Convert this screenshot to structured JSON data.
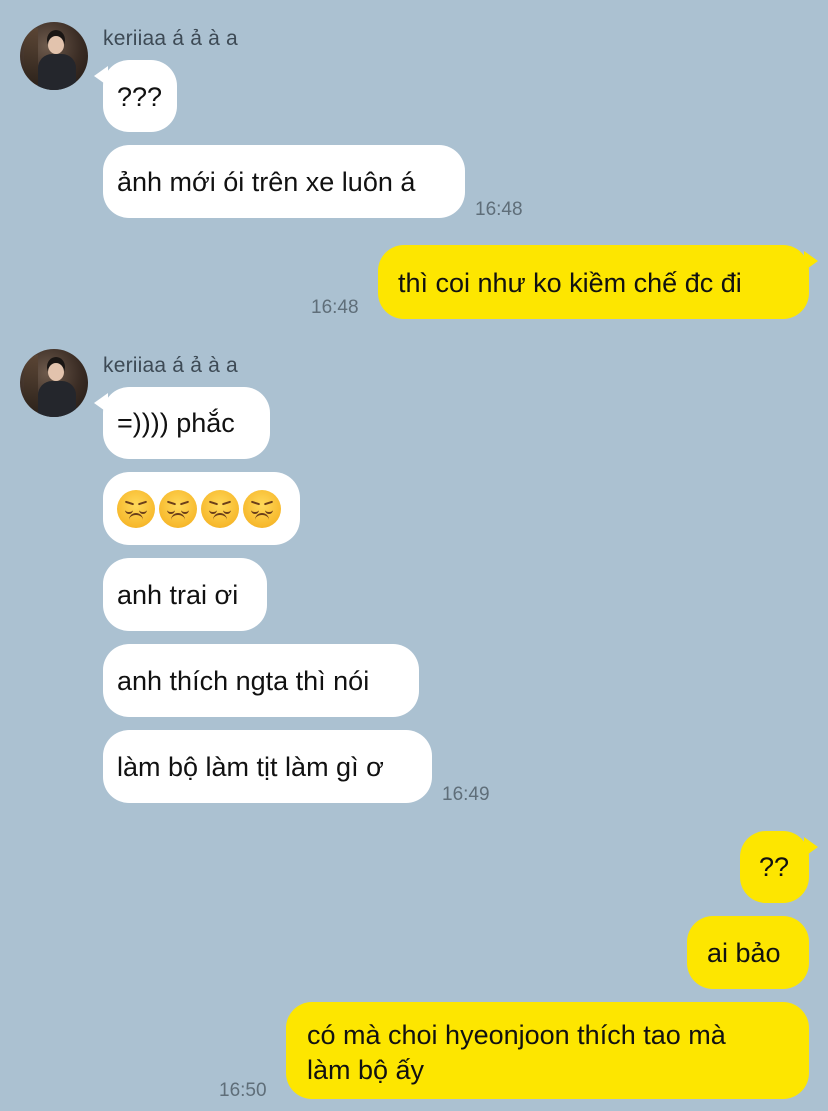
{
  "chat": {
    "contact_name": "keriiaa á ả à a",
    "groups": [
      {
        "time": "16:48",
        "messages": [
          "???",
          "ảnh mới ói trên xe luôn á"
        ]
      },
      {
        "time": "16:48",
        "messages": [
          "thì coi như ko kiềm chế đc đi"
        ]
      },
      {
        "time": "16:49",
        "messages": [
          "=)))) phắc",
          "😞😞😞😞",
          "anh trai ơi",
          "anh thích ngta thì nói",
          "làm bộ làm tịt làm gì ơ"
        ]
      },
      {
        "time": "16:50",
        "messages": [
          "??",
          "ai bảo",
          "có mà choi hyeonjoon thích tao mà",
          "làm bộ ấy"
        ]
      }
    ],
    "emoji_name": "disappointed-face-icon"
  },
  "colors": {
    "background": "#abc1d1",
    "incoming_bubble": "#ffffff",
    "outgoing_bubble": "#fde600",
    "timestamp": "#5f6e79"
  }
}
